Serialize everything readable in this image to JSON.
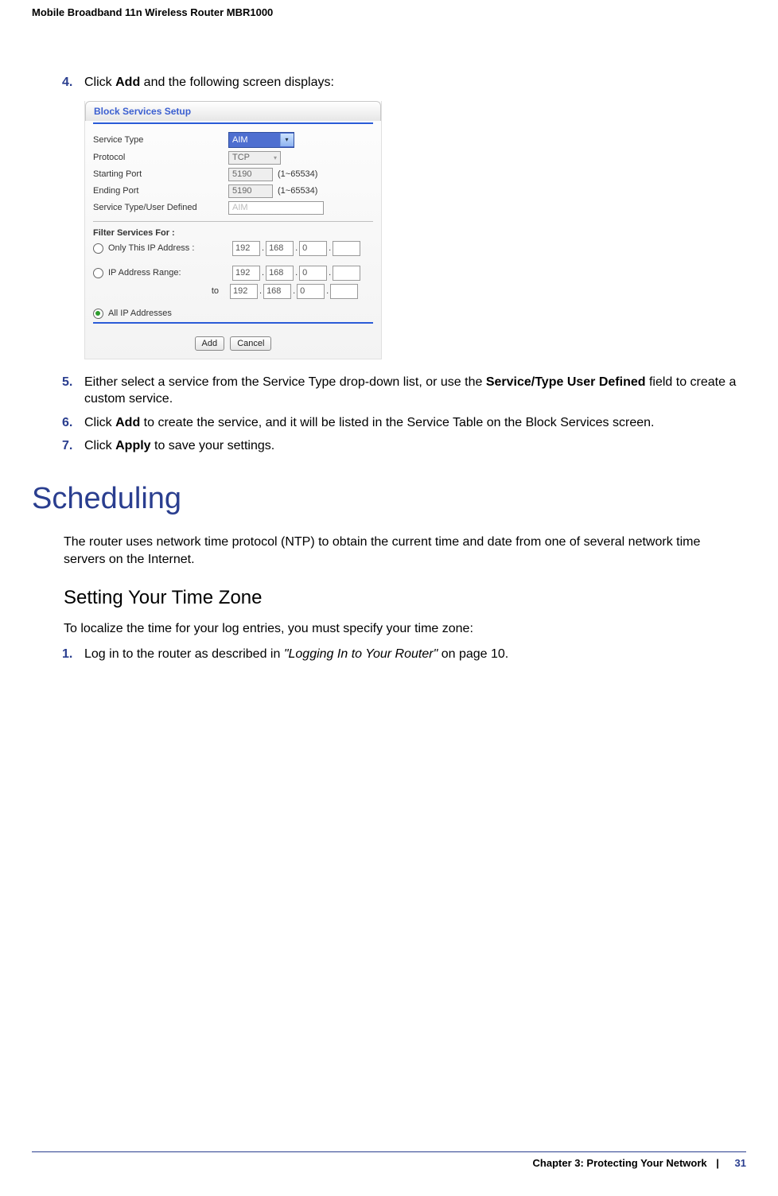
{
  "header": {
    "title": "Mobile Broadband 11n Wireless Router MBR1000"
  },
  "steps_a": {
    "s4": {
      "num": "4.",
      "pre": "Click ",
      "bold": "Add",
      "post": " and the following screen displays:"
    }
  },
  "router": {
    "title": "Block Services Setup",
    "serviceType": {
      "label": "Service Type",
      "value": "AIM"
    },
    "protocol": {
      "label": "Protocol",
      "value": "TCP"
    },
    "startingPort": {
      "label": "Starting Port",
      "value": "5190",
      "range": "(1~65534)"
    },
    "endingPort": {
      "label": "Ending Port",
      "value": "5190",
      "range": "(1~65534)"
    },
    "userDefined": {
      "label": "Service Type/User Defined",
      "value": "AIM"
    },
    "filterTitle": "Filter Services For :",
    "onlyThis": {
      "label": "Only This IP Address :",
      "ip": [
        "192",
        "168",
        "0",
        ""
      ]
    },
    "range": {
      "label": "IP Address Range:",
      "from": [
        "192",
        "168",
        "0",
        ""
      ],
      "toLabel": "to",
      "to": [
        "192",
        "168",
        "0",
        ""
      ]
    },
    "all": {
      "label": "All IP Addresses"
    },
    "btnAdd": "Add",
    "btnCancel": "Cancel"
  },
  "steps_b": {
    "s5": {
      "num": "5.",
      "t1": "Either select a service from the Service Type drop-down list, or use the ",
      "b1": "Service/Type User Defined",
      "t2": " field to create a custom service."
    },
    "s6": {
      "num": "6.",
      "t1": "Click ",
      "b1": "Add",
      "t2": " to create the service, and it will be listed in the Service Table on the Block Services screen."
    },
    "s7": {
      "num": "7.",
      "t1": "Click ",
      "b1": "Apply",
      "t2": " to save your settings."
    }
  },
  "scheduling": {
    "title": "Scheduling",
    "para": "The router uses network time protocol (NTP) to obtain the current time and date from one of several network time servers on the Internet."
  },
  "stz": {
    "title": "Setting Your Time Zone",
    "intro": "To localize the time for your log entries, you must specify your time zone:",
    "s1": {
      "num": "1.",
      "t1": "Log in to the router as described in ",
      "i1": "\"Logging In to Your Router\"",
      "t2": " on page 10."
    }
  },
  "footer": {
    "chapter": "Chapter 3:  Protecting Your Network",
    "sep": "|",
    "page": "31"
  }
}
